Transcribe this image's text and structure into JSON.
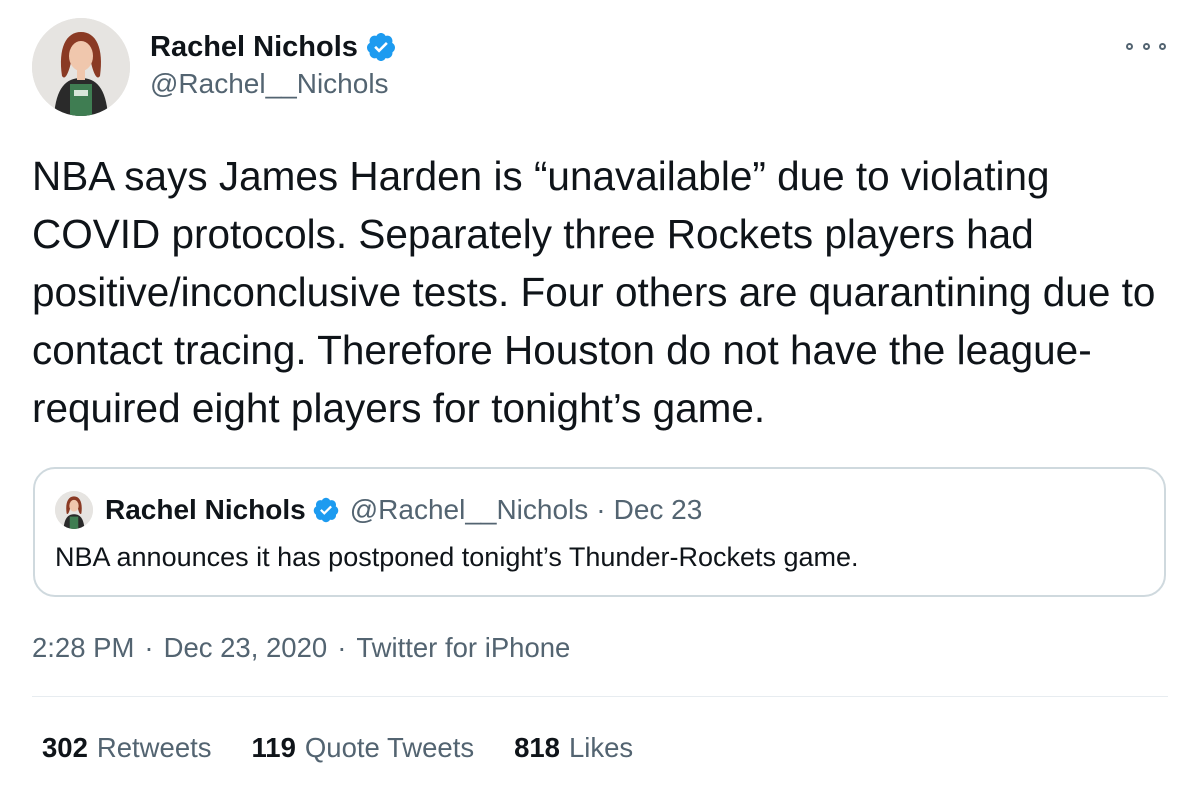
{
  "author": {
    "display_name": "Rachel Nichols",
    "handle": "@Rachel__Nichols",
    "verified": true
  },
  "tweet": {
    "text": "NBA says James Harden is “unavailable” due to violating COVID protocols. Separately three Rockets players had positive/inconclusive tests. Four others are quarantining due to contact tracing. Therefore Houston do not have the league-required eight players for tonight’s game."
  },
  "quoted_tweet": {
    "display_name": "Rachel Nichols",
    "handle": "@Rachel__Nichols",
    "separator": "·",
    "date": "Dec 23",
    "text": "NBA announces it has postponed tonight’s Thunder-Rockets game."
  },
  "meta": {
    "time": "2:28 PM",
    "separator": "·",
    "date": "Dec 23, 2020",
    "source": "Twitter for iPhone"
  },
  "stats": {
    "retweets": {
      "count": "302",
      "label": "Retweets"
    },
    "quote_tweets": {
      "count": "119",
      "label": "Quote Tweets"
    },
    "likes": {
      "count": "818",
      "label": "Likes"
    }
  },
  "colors": {
    "verified_blue": "#1d9bf0",
    "secondary_text": "#536471",
    "border": "#cfd9de"
  },
  "icons": {
    "verified": "verified-badge-icon",
    "more": "more-options-icon"
  }
}
